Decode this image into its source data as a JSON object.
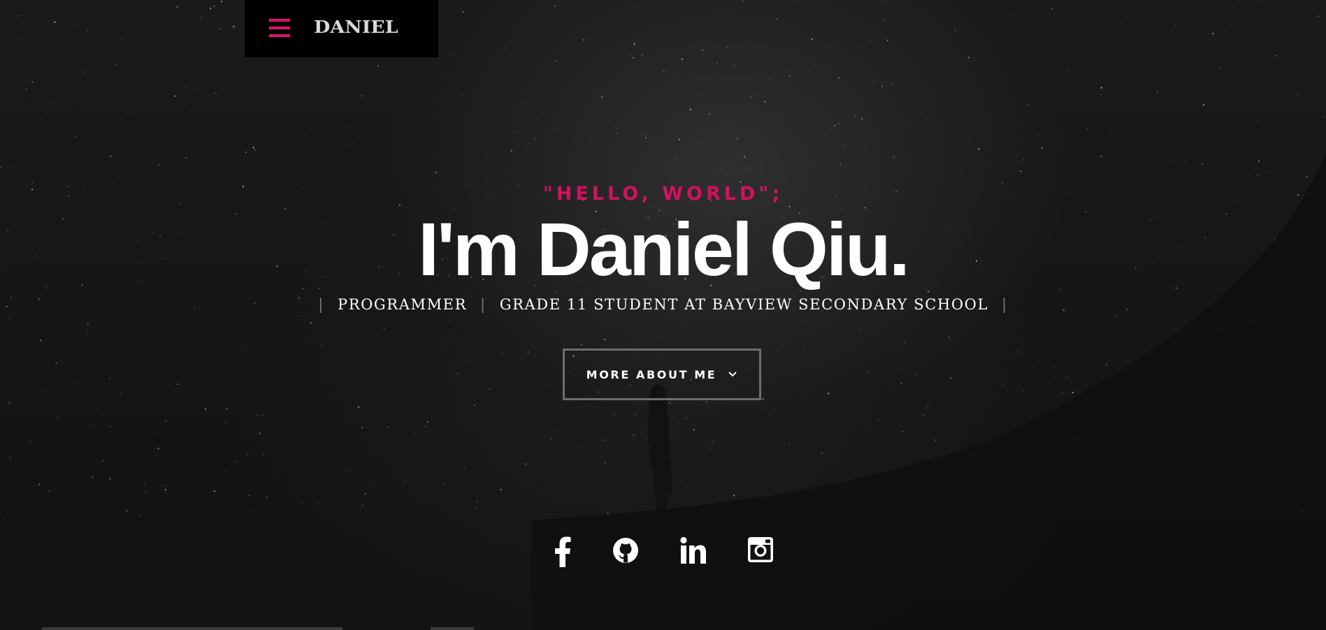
{
  "header": {
    "logo_text": "DANIEL",
    "menu_icon": "hamburger-menu-icon",
    "accent_color": "#e0116c"
  },
  "intro": {
    "pretitle": "\"HELLO, WORLD\";",
    "title": "I'm Daniel Qiu.",
    "positions": [
      "PROGRAMMER",
      "GRADE 11 STUDENT AT BAYVIEW SECONDARY SCHOOL"
    ],
    "separator": "|",
    "more_button_label": "MORE ABOUT ME",
    "more_button_icon": "chevron-down-icon"
  },
  "social": [
    {
      "name": "facebook",
      "icon": "facebook-icon"
    },
    {
      "name": "github",
      "icon": "github-icon"
    },
    {
      "name": "linkedin",
      "icon": "linkedin-icon"
    },
    {
      "name": "instagram",
      "icon": "instagram-icon"
    }
  ]
}
